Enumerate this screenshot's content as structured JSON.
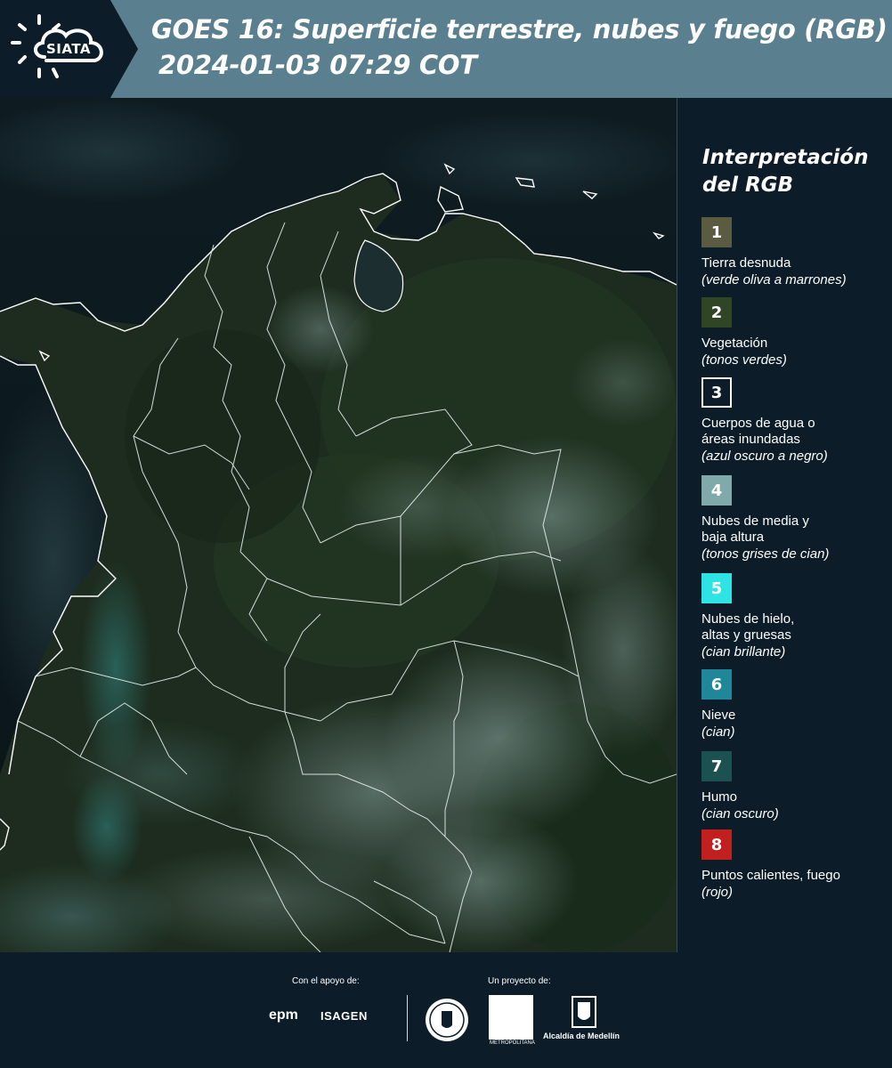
{
  "header": {
    "logo_text": "SIATA",
    "title_line1": "GOES 16: Superficie terrestre, nubes y fuego (RGB)",
    "title_line2": "2024-01-03 07:29 COT"
  },
  "legend": {
    "title": "Interpretación\ndel RGB",
    "items": [
      {
        "number": "1",
        "label": "Tierra desnuda",
        "description": "(verde oliva a marrones)",
        "color": "#5b5b41",
        "border": "#5b5b41",
        "text_color": "#ffffff"
      },
      {
        "number": "2",
        "label": "Vegetación",
        "description": "(tonos verdes)",
        "color": "#2f4524",
        "border": "#2f4524",
        "text_color": "#ffffff"
      },
      {
        "number": "3",
        "label": "Cuerpos de agua o\náreas inundadas",
        "description": "(azul oscuro a negro)",
        "color": "#0c1d29",
        "border": "#ffffff",
        "text_color": "#ffffff"
      },
      {
        "number": "4",
        "label": "Nubes de media y\nbaja altura",
        "description": "(tonos grises de cian)",
        "color": "#7fa9aa",
        "border": "#7fa9aa",
        "text_color": "#ffffff"
      },
      {
        "number": "5",
        "label": "Nubes de hielo,\naltas y gruesas",
        "description": "(cian brillante)",
        "color": "#2ee3e3",
        "border": "#2ee3e3",
        "text_color": "#ffffff"
      },
      {
        "number": "6",
        "label": "Nieve",
        "description": "(cian)",
        "color": "#1f8799",
        "border": "#1f8799",
        "text_color": "#ffffff"
      },
      {
        "number": "7",
        "label": "Humo",
        "description": "(cian oscuro)",
        "color": "#1c5151",
        "border": "#1c5151",
        "text_color": "#ffffff"
      },
      {
        "number": "8",
        "label": "Puntos calientes, fuego",
        "description": "(rojo)",
        "color": "#c21f1f",
        "border": "#c21f1f",
        "text_color": "#ffffff"
      }
    ]
  },
  "footer": {
    "support_label": "Con el apoyo de:",
    "project_label": "Un proyecto de:",
    "epm": "epm",
    "isagen": "ISAGEN",
    "area_metropolitana": "METROPOLITANA",
    "alcaldia": "Alcaldía de Medellín"
  },
  "colors": {
    "background": "#0c1d29",
    "header_band": "#5a8090",
    "vegetation_dark": "#1e2e1d",
    "ocean": "#0b1a1d",
    "cloud": "#8fb0b4",
    "border_line": "#ffffff"
  }
}
